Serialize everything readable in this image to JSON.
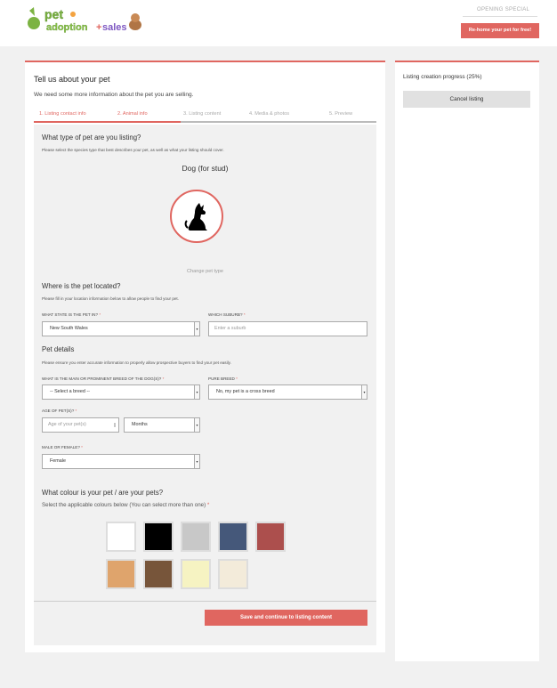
{
  "header": {
    "opening_special": "OPENING SPECIAL",
    "rehome_label": "Re-home your pet for free!"
  },
  "main": {
    "title": "Tell us about your pet",
    "subtitle": "We need some more information about the pet you are selling.",
    "steps": [
      {
        "label": "1. Listing contact info",
        "state": "done"
      },
      {
        "label": "2. Animal info",
        "state": "current"
      },
      {
        "label": "3. Listing content",
        "state": "todo"
      },
      {
        "label": "4. Media & photos",
        "state": "todo"
      },
      {
        "label": "5. Preview",
        "state": "todo"
      }
    ],
    "pet_type": {
      "heading": "What type of pet are you listing?",
      "description": "Please select the species type that best describes your pet, as well as what your listing should cover.",
      "selected": "Dog (for stud)",
      "icon": "dog-icon",
      "change_label": "Change pet type"
    },
    "location": {
      "heading": "Where is the pet located?",
      "description": "Please fill in your location information below to allow people to find your pet.",
      "state_label": "WHAT STATE IS THE PET IN?",
      "state_value": "New South Wales",
      "suburb_label": "WHICH SUBURB?",
      "suburb_placeholder": "Enter a suburb"
    },
    "details": {
      "heading": "Pet details",
      "description": "Please ensure you enter accurate information to properly allow prospective buyers to find your pet easily.",
      "breed_label": "WHAT IS THE MAIN OR PROMINENT BREED OF THE DOG(S)?",
      "breed_value": "-- Select a breed --",
      "pure_label": "PURE BREED",
      "pure_value": "No, my pet is a cross breed",
      "age_label": "AGE OF PET(S)?",
      "age_placeholder": "Age of your pet(s)",
      "age_unit": "Months",
      "sex_label": "MALE OR FEMALE?",
      "sex_value": "Female"
    },
    "colours": {
      "heading": "What colour is your pet / are your pets?",
      "description": "Select the applicable colours below (You can select more than one)",
      "swatches": [
        "#ffffff",
        "#000000",
        "#c8c8c8",
        "#45587a",
        "#ac4f4d",
        "#dfa46c",
        "#77553a",
        "#f6f3c2",
        "#f3ebda"
      ]
    },
    "save_label": "Save and continue to listing content"
  },
  "sidebar": {
    "progress_label": "Listing creation progress (25%)",
    "progress_percent": 25,
    "cancel_label": "Cancel listing"
  },
  "colors": {
    "accent": "#e06660"
  }
}
